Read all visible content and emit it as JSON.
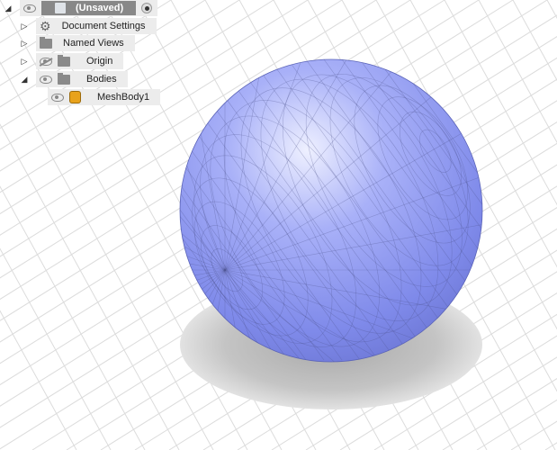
{
  "browser": {
    "root": {
      "label": "(Unsaved)",
      "expanded": true
    },
    "items": [
      {
        "label": "Document Settings",
        "icon": "gear-icon",
        "expanded": false
      },
      {
        "label": "Named Views",
        "icon": "folder-icon",
        "expanded": false
      },
      {
        "label": "Origin",
        "icon": "folder-icon",
        "expanded": false,
        "visible": false
      },
      {
        "label": "Bodies",
        "icon": "folder-icon",
        "expanded": true,
        "visible": true
      }
    ],
    "bodies": [
      {
        "label": "MeshBody1",
        "icon": "mesh-body-icon",
        "visible": true
      }
    ]
  },
  "colors": {
    "sphere": "#8c96f0",
    "mesh_lines": "#4a4f8a",
    "grid": "#dcdcdc",
    "shadow": "#bdbdbd"
  }
}
